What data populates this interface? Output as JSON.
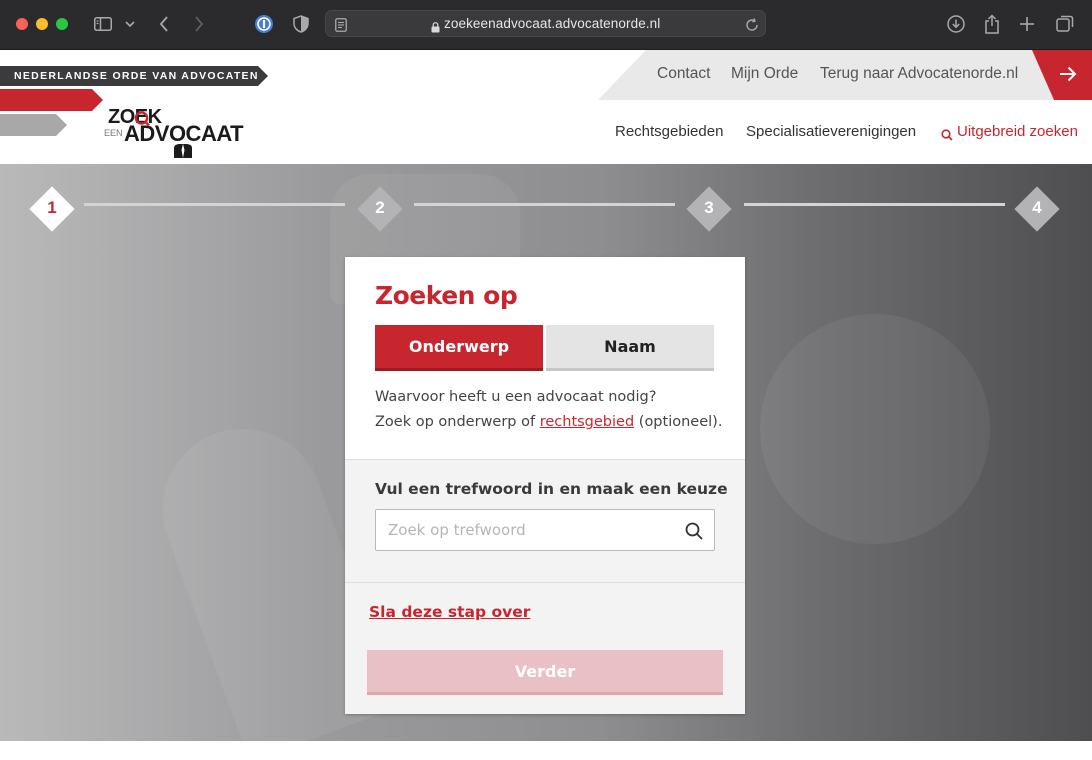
{
  "browser": {
    "url": "zoekeenadvocaat.advocatenorde.nl",
    "icons": [
      "sidebar-icon",
      "chevron-down-icon",
      "back-icon",
      "forward-icon",
      "password-manager-icon",
      "shield-icon",
      "page-icon",
      "lock-icon",
      "reload-icon",
      "download-icon",
      "share-icon",
      "new-tab-icon",
      "tabs-overview-icon"
    ]
  },
  "header": {
    "banner": "NEDERLANDSE ORDE VAN ADVOCATEN",
    "top_links": [
      "Contact",
      "Mijn Orde",
      "Terug naar Advocatenorde.nl"
    ],
    "logo": {
      "line1": "ZOEK",
      "small": "EEN",
      "line2": "ADVOCAAT"
    },
    "nav": [
      "Rechtsgebieden",
      "Specialisatieverenigingen",
      "Uitgebreid zoeken"
    ]
  },
  "steps": [
    "1",
    "2",
    "3",
    "4"
  ],
  "active_step": 1,
  "card": {
    "title": "Zoeken op",
    "tabs": [
      "Onderwerp",
      "Naam"
    ],
    "active_tab": "Onderwerp",
    "desc_line1": "Waarvoor heeft u een advocaat nodig?",
    "desc_line2_prefix": "Zoek op onderwerp of ",
    "desc_link": "rechtsgebied",
    "desc_line2_suffix": " (optioneel).",
    "field_label": "Vul een trefwoord in en maak een keuze",
    "search_placeholder": "Zoek op trefwoord",
    "skip_link": "Sla deze stap over",
    "next_button": "Verder"
  },
  "colors": {
    "brand_red": "#c8262f",
    "disabled_button": "#e9c0c3"
  }
}
